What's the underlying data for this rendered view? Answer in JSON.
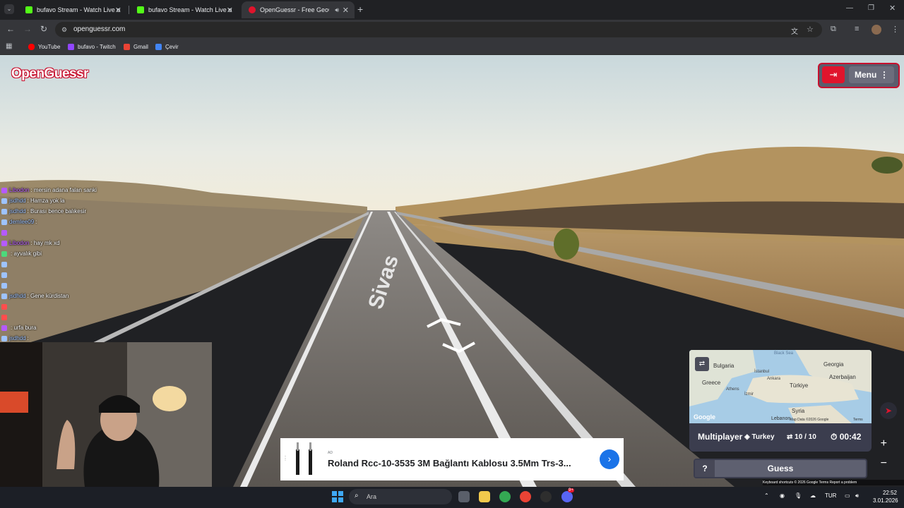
{
  "tabs": [
    {
      "title": "bufavo Stream - Watch Live on",
      "color": "#53fc18"
    },
    {
      "title": "bufavo Stream - Watch Live on",
      "color": "#53fc18"
    },
    {
      "title": "OpenGuessr - Free GeoGue",
      "color": "#e0142c"
    }
  ],
  "new_tab": "+",
  "url": "openguessr.com",
  "bookmarks": [
    {
      "label": "YouTube",
      "color": "#ff0000"
    },
    {
      "label": "bufavo - Twitch",
      "color": "#9146ff"
    },
    {
      "label": "Gmail",
      "color": "#ea4335"
    },
    {
      "label": "Çevir",
      "color": "#4285f4"
    }
  ],
  "logo": "OpenGuessr",
  "menu_label": "Menu",
  "road_text": "Sivas",
  "chat": [
    {
      "user": "Libodon",
      "msg": ": mersin adana falan sanki",
      "ucolor": "#b55aff"
    },
    {
      "user": "jsdhdd",
      "msg": ": Hamza yok la",
      "ucolor": "#9ec3ff"
    },
    {
      "user": "jsdhdd",
      "msg": ": Burası bence balıkesir",
      "ucolor": "#9ec3ff"
    },
    {
      "user": "demlee09",
      "msg": ":",
      "ucolor": "#9ec3ff"
    },
    {
      "user": "",
      "msg": "",
      "ucolor": "#b55aff"
    },
    {
      "user": "Libodon",
      "msg": ": hay mk xd",
      "ucolor": "#b55aff"
    },
    {
      "user": "",
      "msg": ": ayvalık gibi",
      "ucolor": "#4cd97b"
    },
    {
      "user": "",
      "msg": "",
      "ucolor": "#9ec3ff"
    },
    {
      "user": "",
      "msg": "",
      "ucolor": "#9ec3ff"
    },
    {
      "user": "",
      "msg": "",
      "ucolor": "#9ec3ff"
    },
    {
      "user": "jsdhdd",
      "msg": ": Gene kürdistan",
      "ucolor": "#9ec3ff"
    },
    {
      "user": "",
      "msg": "",
      "ucolor": "#ff4d4d"
    },
    {
      "user": "",
      "msg": "",
      "ucolor": "#ff4d4d"
    },
    {
      "user": "",
      "msg": ": urfa bura",
      "ucolor": "#b55aff"
    },
    {
      "user": "jsdhdd",
      "msg": ":",
      "ucolor": "#9ec3ff"
    }
  ],
  "map": {
    "labels": [
      {
        "text": "Black Sea",
        "small": true
      },
      {
        "text": "Bulgaria"
      },
      {
        "text": "Georgia"
      },
      {
        "text": "İstanbul",
        "small": true
      },
      {
        "text": "Azerbaijan"
      },
      {
        "text": "Ankara",
        "small": true
      },
      {
        "text": "Greece"
      },
      {
        "text": "Türkiye"
      },
      {
        "text": "Athens",
        "small": true
      },
      {
        "text": "İzmir",
        "small": true
      },
      {
        "text": "Syria"
      },
      {
        "text": "Lebanon"
      }
    ],
    "attribution": "Map Data ©2026 Google",
    "terms": "Terms",
    "google": "Google"
  },
  "game": {
    "mode": "Multiplayer",
    "country": "Turkey",
    "round": "10 / 10",
    "timer": "00:42",
    "guess_label": "Guess",
    "help_label": "?"
  },
  "ad": {
    "tag": "AD",
    "title": "Roland Rcc-10-3535 3M Bağlantı Kablosu 3.5Mm Trs-3..."
  },
  "attrib_bar": "Keyboard shortcuts   © 2026 Google   Terms   Report a problem",
  "taskbar": {
    "search_placeholder": "Ara",
    "lang": "TUR",
    "time": "22:52",
    "date": "3.01.2026",
    "discord_badge": "9+"
  }
}
